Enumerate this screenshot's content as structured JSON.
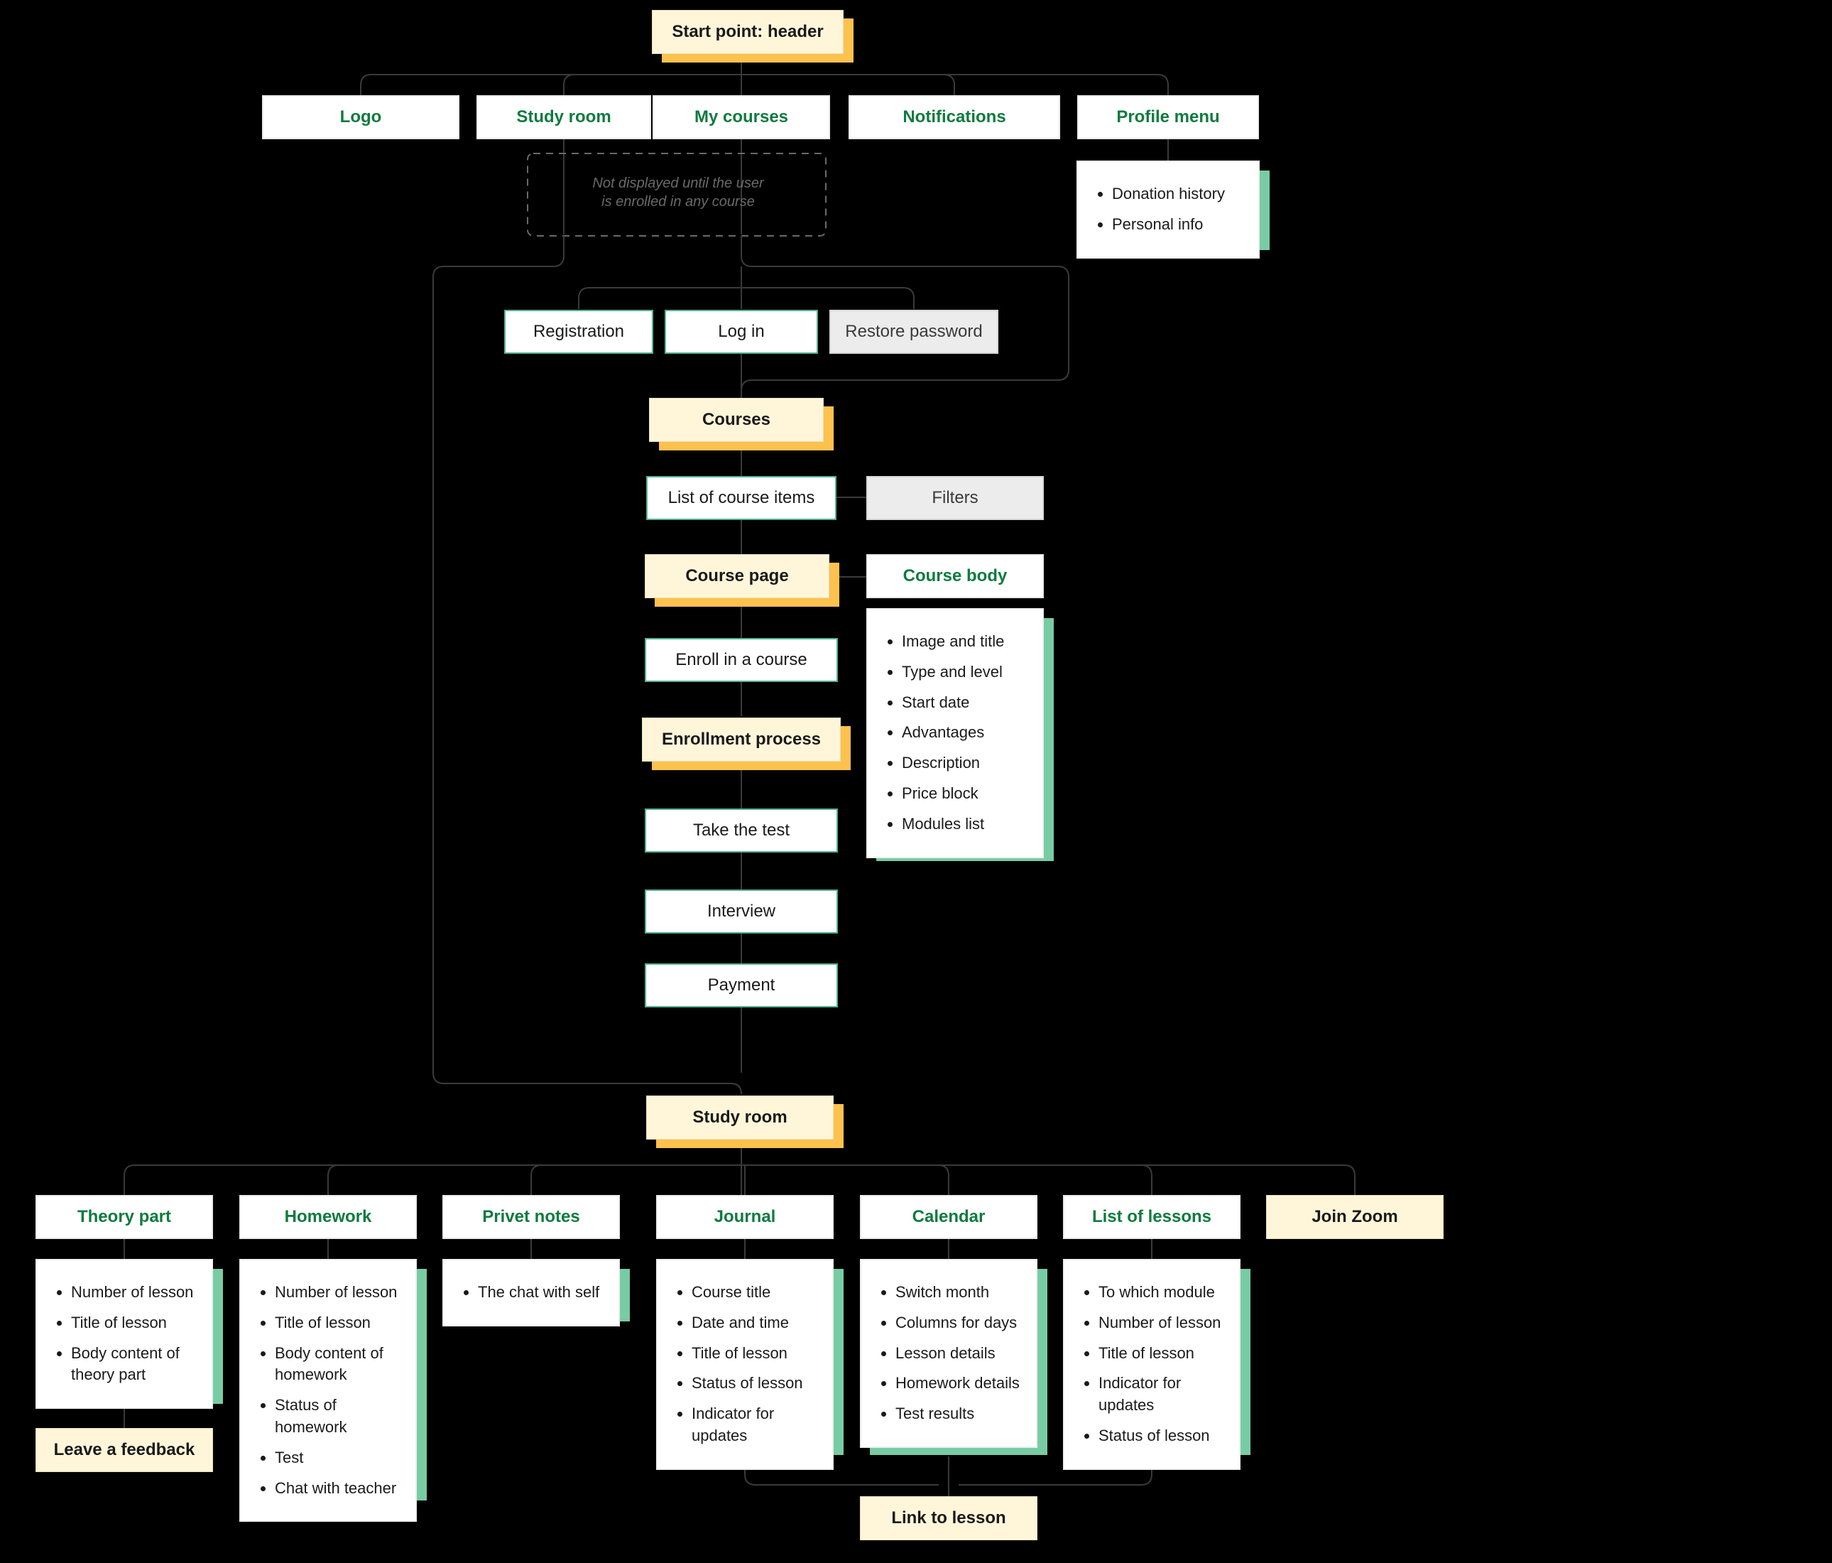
{
  "start": "Start point: header",
  "nav": {
    "logo": "Logo",
    "study_room": "Study room",
    "my_courses": "My courses",
    "notifications": "Notifications",
    "profile_menu": "Profile menu"
  },
  "note_not_enrolled_l1": "Not displayed until the user",
  "note_not_enrolled_l2": "is enrolled in any course",
  "profile_items": [
    "Donation history",
    "Personal info"
  ],
  "auth": {
    "registration": "Registration",
    "login": "Log in",
    "restore": "Restore password"
  },
  "courses": {
    "node": "Courses",
    "list": "List of course items",
    "filters": "Filters",
    "page": "Course page",
    "body_head": "Course body",
    "body_items": [
      "Image and title",
      "Type and level",
      "Start date",
      "Advantages",
      "Description",
      "Price block",
      "Modules list"
    ],
    "enroll": "Enroll in a course",
    "process": "Enrollment process",
    "test": "Take the test",
    "interview": "Interview",
    "payment": "Payment"
  },
  "study": {
    "node": "Study room",
    "theory_head": "Theory part",
    "theory_items": [
      "Number of lesson",
      "Title of lesson",
      "Body content of theory part"
    ],
    "leave_feedback": "Leave a feedback",
    "homework_head": "Homework",
    "homework_items": [
      "Number of lesson",
      "Title of lesson",
      "Body content of homework",
      "Status of homework",
      "Test",
      "Chat with teacher"
    ],
    "notes_head": "Privet notes",
    "notes_items": [
      "The chat with self"
    ],
    "journal_head": "Journal",
    "journal_items": [
      "Course title",
      "Date and time",
      "Title of lesson",
      "Status of lesson",
      "Indicator for updates"
    ],
    "calendar_head": "Calendar",
    "calendar_items": [
      "Switch month",
      "Columns for days",
      "Lesson details",
      "Homework details",
      "Test results"
    ],
    "lessons_head": "List of lessons",
    "lessons_items": [
      "To which module",
      "Number of lesson",
      "Title of lesson",
      "Indicator for updates",
      "Status of lesson"
    ],
    "join_zoom": "Join Zoom",
    "link_lesson": "Link to lesson"
  }
}
